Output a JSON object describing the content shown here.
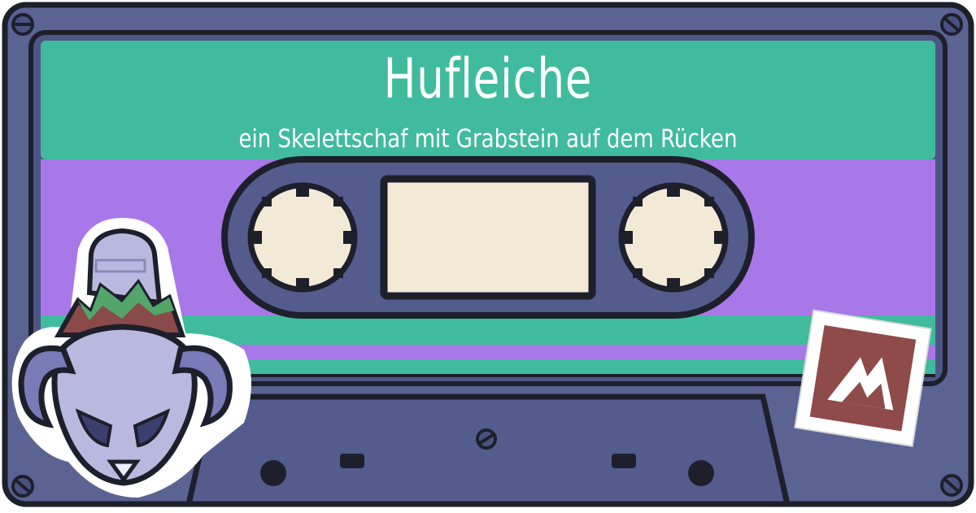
{
  "cassette": {
    "title": "Hufleiche",
    "subtitle": "ein Skelettschaf mit Grabstein auf dem Rücken"
  },
  "colors": {
    "shell": "#5a6392",
    "outline": "#1d1f2b",
    "label_green": "#40bb9d",
    "label_purple": "#a877e8",
    "reel_cream": "#f2ead7",
    "badge_red": "#8f4a4a",
    "mascot_pale": "#b9b9e0",
    "mascot_green": "#53a56a",
    "mascot_brown": "#8a4a4a"
  },
  "icons": [
    "screw-icon",
    "mountain-badge-icon",
    "skeleton-sheep-icon"
  ]
}
